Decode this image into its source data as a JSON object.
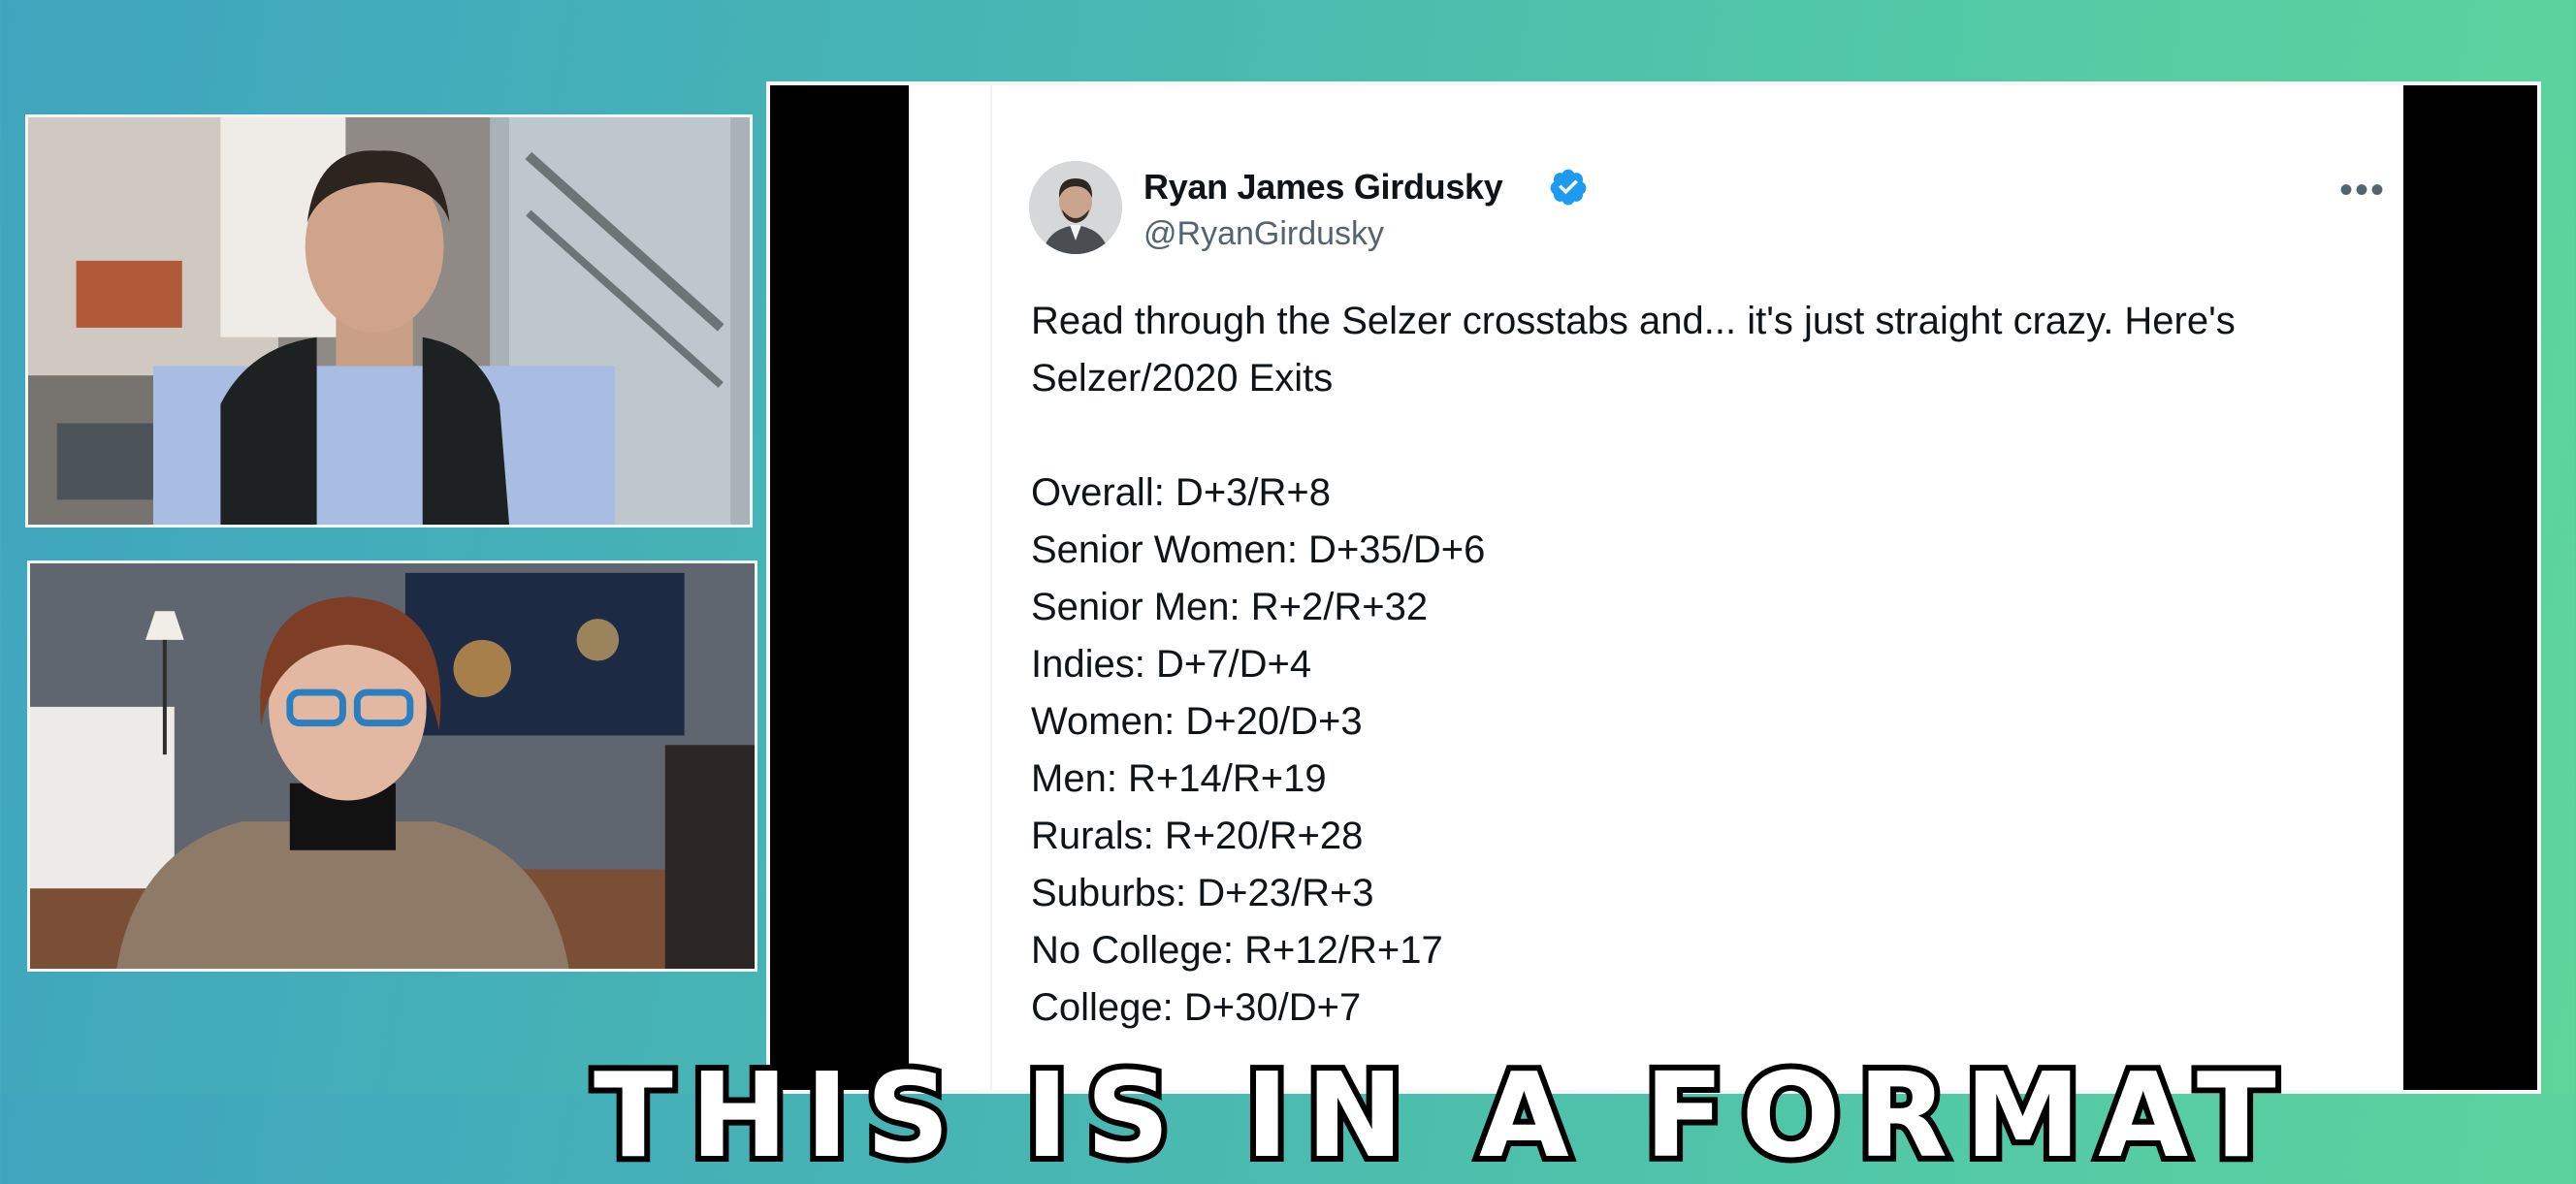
{
  "tweet": {
    "author_name": "Ryan James Girdusky",
    "author_handle": "@RyanGirdusky",
    "verified": true,
    "more_icon": "more-horizontal-icon",
    "intro_lines": [
      "Read through the Selzer crosstabs and... it's just straight crazy. Here's",
      "Selzer/2020 Exits"
    ],
    "stats": [
      "Overall: D+3/R+8",
      "Senior Women: D+35/D+6",
      "Senior Men: R+2/R+32",
      "Indies: D+7/D+4",
      "Women: D+20/D+3",
      "Men: R+14/R+19",
      "Rurals: R+20/R+28",
      "Suburbs: D+23/R+3",
      "No College: R+12/R+17",
      "College: D+30/D+7"
    ]
  },
  "caption": {
    "text": "THIS IS IN A FORMAT"
  },
  "colors": {
    "background_start": "#3fa5bf",
    "background_end": "#5fd59b",
    "verified_badge": "#1d9bf0",
    "text_primary": "#0f1419",
    "text_secondary": "#536471"
  }
}
